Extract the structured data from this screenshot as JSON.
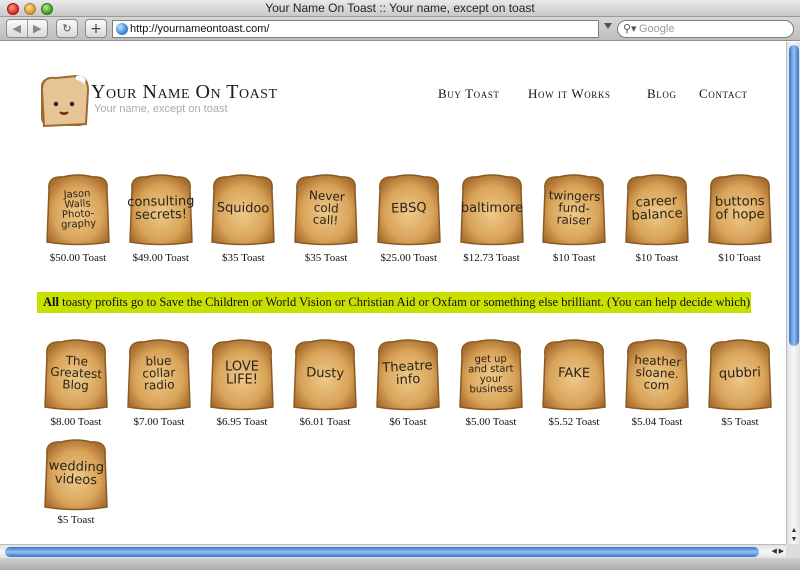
{
  "window": {
    "title": "Your Name On Toast :: Your name, except on toast",
    "url": "http://yournameontoast.com/",
    "search_placeholder": "Google"
  },
  "site": {
    "title": "Your Name On Toast",
    "tagline": "Your name, except on toast"
  },
  "nav": {
    "buy": "Buy Toast",
    "how": "How it Works",
    "blog": "Blog",
    "contact": "Contact"
  },
  "banner": {
    "bold": "All",
    "text": " toasty profits go to Save the Children or World Vision or Christian Aid or Oxfam or something else brilliant. (You can help decide which)."
  },
  "toasts_row1": [
    {
      "text": "Jason Walls Photo- graphy",
      "price": "$50.00 Toast"
    },
    {
      "text": "consulting secrets!",
      "price": "$49.00 Toast"
    },
    {
      "text": "Squidoo",
      "price": "$35 Toast"
    },
    {
      "text": "Never cold call!",
      "price": "$35 Toast"
    },
    {
      "text": "EBSQ",
      "price": "$25.00 Toast"
    },
    {
      "text": "baltimore",
      "price": "$12.73 Toast"
    },
    {
      "text": "twingers fund- raiser",
      "price": "$10 Toast"
    },
    {
      "text": "career balance",
      "price": "$10 Toast"
    },
    {
      "text": "buttons of hope",
      "price": "$10 Toast"
    }
  ],
  "toasts_row2": [
    {
      "text": "The Greatest Blog",
      "price": "$8.00 Toast"
    },
    {
      "text": "blue collar radio",
      "price": "$7.00 Toast"
    },
    {
      "text": "LOVE LIFE!",
      "price": "$6.95 Toast"
    },
    {
      "text": "Dusty",
      "price": "$6.01 Toast"
    },
    {
      "text": "Theatre info",
      "price": "$6 Toast"
    },
    {
      "text": "get up and start your business",
      "price": "$5.00 Toast"
    },
    {
      "text": "FAKE",
      "price": "$5.52 Toast"
    },
    {
      "text": "heather sloane. com",
      "price": "$5.04 Toast"
    },
    {
      "text": "qubbri",
      "price": "$5 Toast"
    }
  ],
  "toasts_row3": [
    {
      "text": "wedding videos",
      "price": "$5 Toast"
    }
  ],
  "colors": {
    "banner": "#c8e000",
    "toast_crust": "#b07a3a",
    "toast_inner": "#e3b76e"
  }
}
